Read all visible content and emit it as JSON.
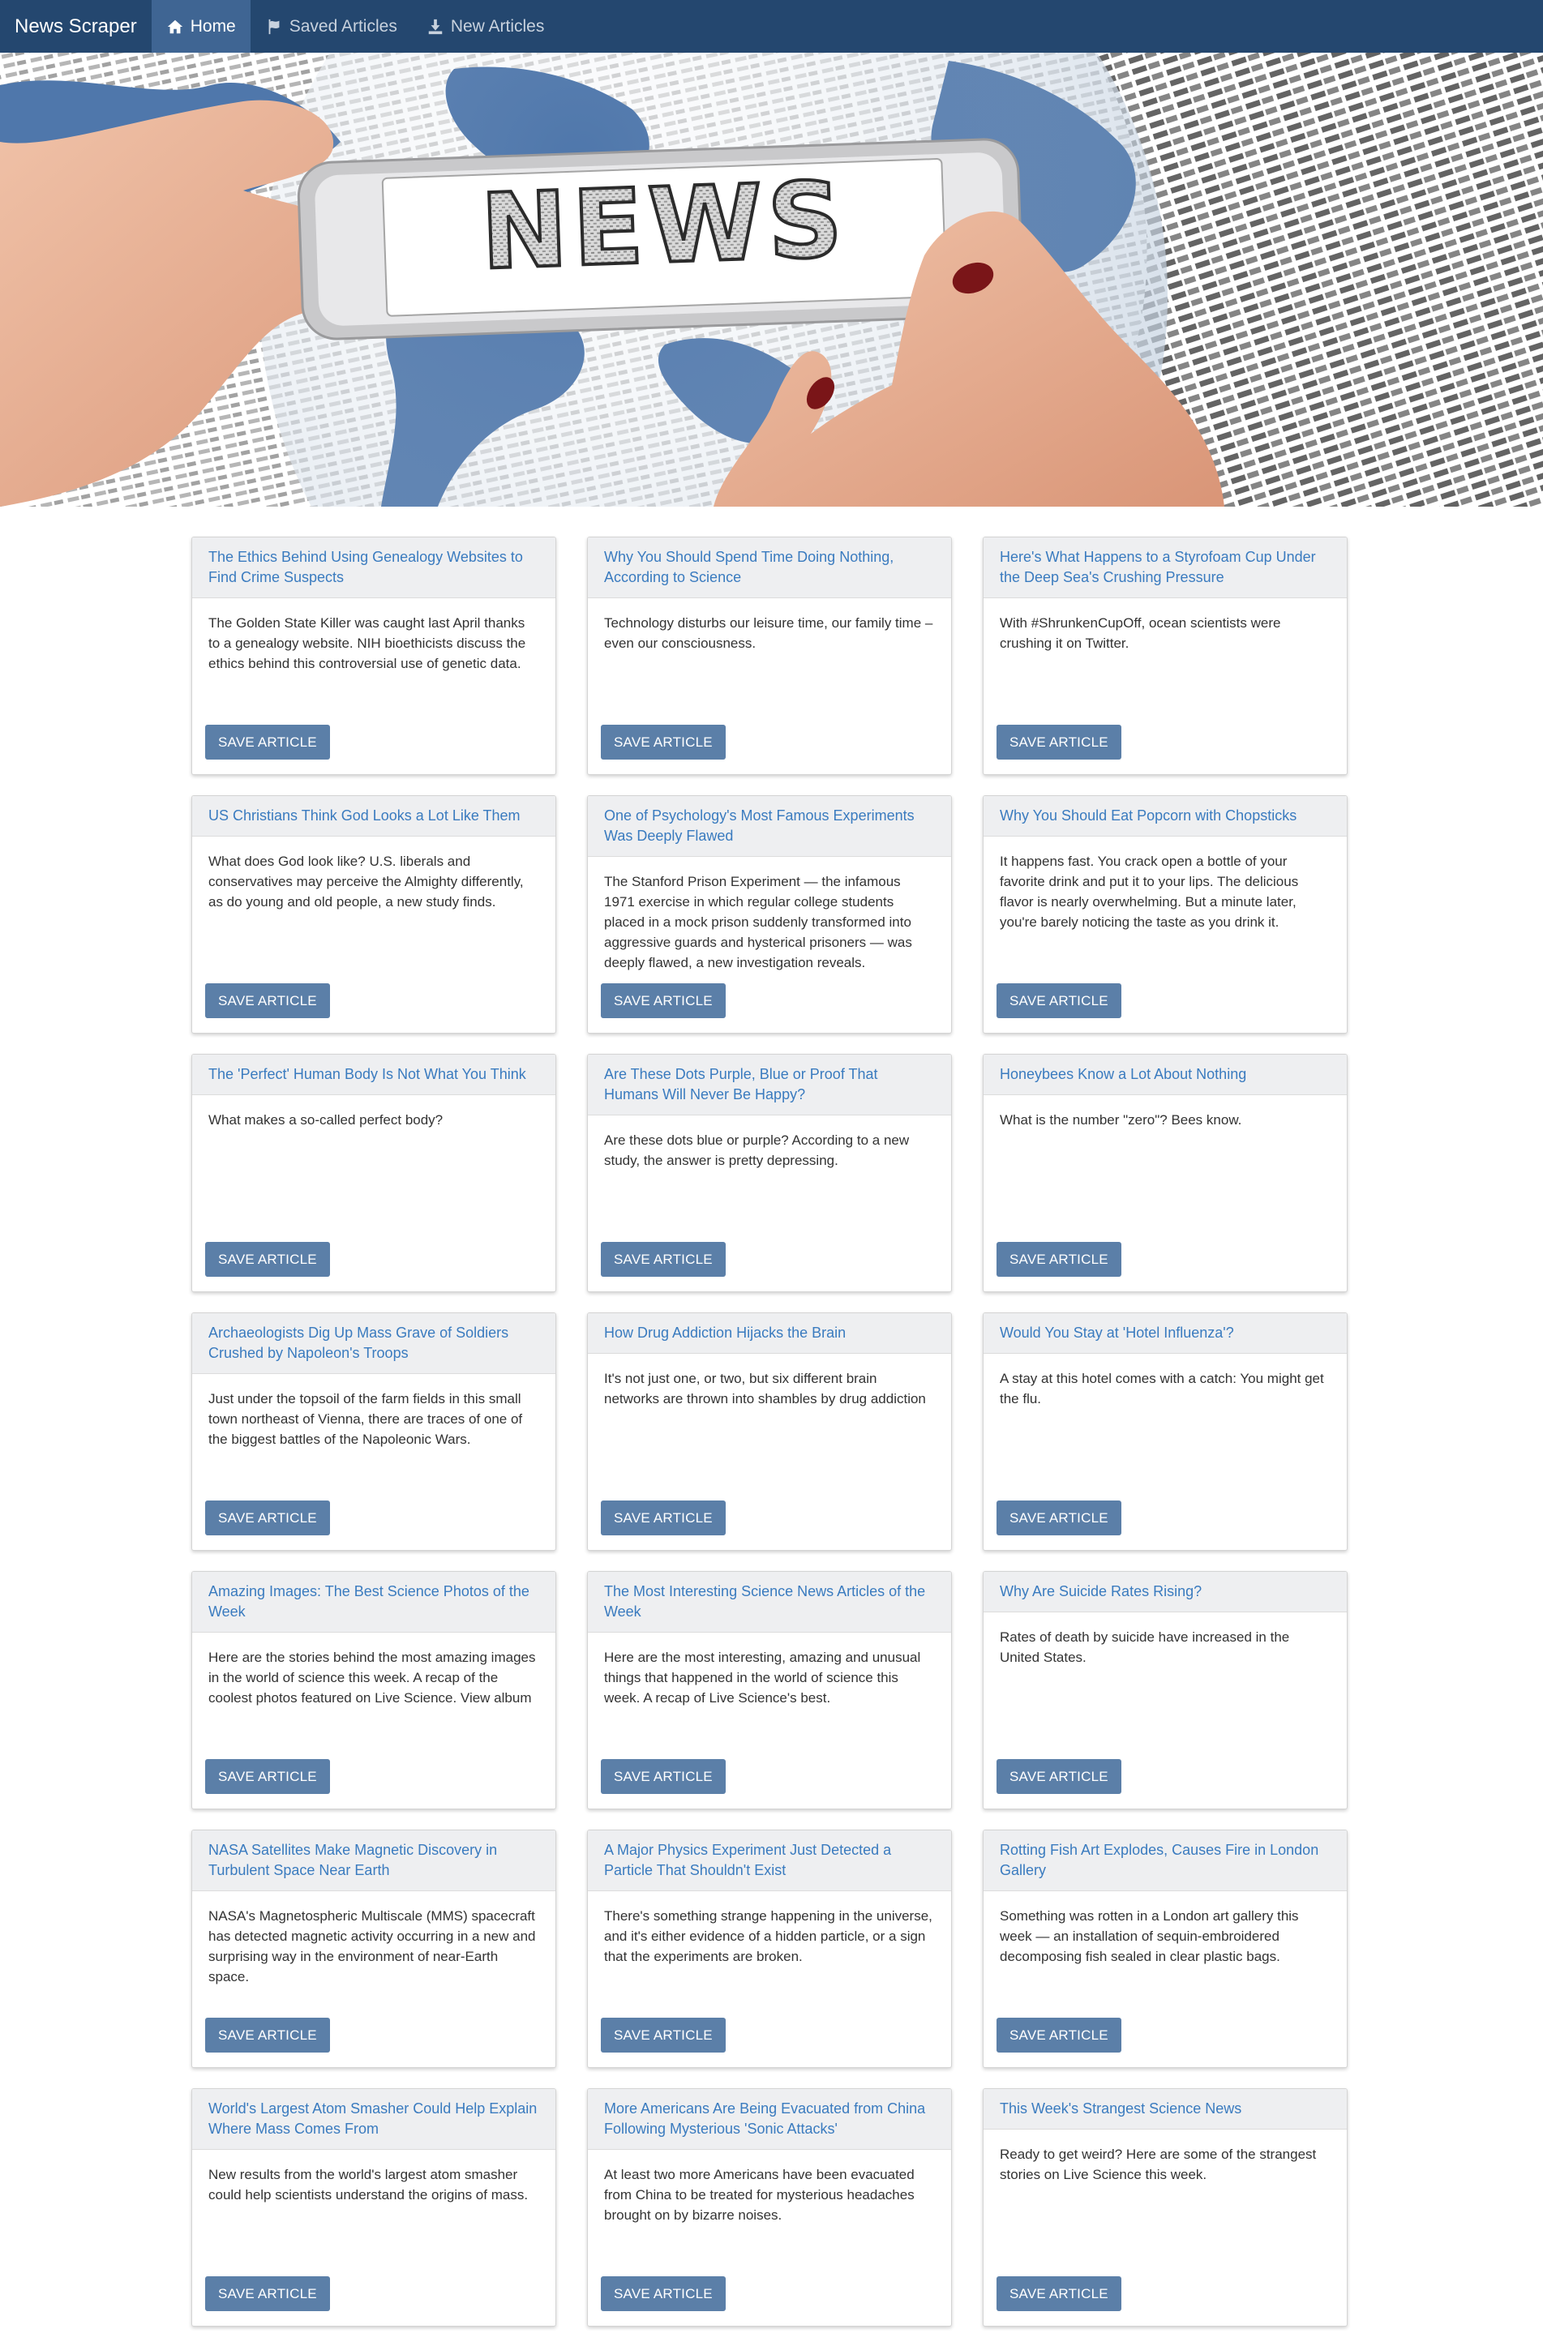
{
  "navbar": {
    "brand": "News Scraper",
    "items": [
      {
        "label": "Home",
        "icon": "home-icon",
        "active": true
      },
      {
        "label": "Saved Articles",
        "icon": "flag-icon",
        "active": false
      },
      {
        "label": "New Articles",
        "icon": "download-icon",
        "active": false
      }
    ]
  },
  "hero": {
    "screen_text": "NEWS"
  },
  "articles": [
    {
      "title": "The Ethics Behind Using Genealogy Websites to Find Crime Suspects",
      "summary": "The Golden State Killer was caught last April thanks to a genealogy website. NIH bioethicists discuss the ethics behind this controversial use of genetic data.",
      "button": "SAVE ARTICLE"
    },
    {
      "title": "Why You Should Spend Time Doing Nothing, According to Science",
      "summary": "Technology disturbs our leisure time, our family time – even our consciousness.",
      "button": "SAVE ARTICLE"
    },
    {
      "title": "Here's What Happens to a Styrofoam Cup Under the Deep Sea's Crushing Pressure",
      "summary": "With #ShrunkenCupOff, ocean scientists were crushing it on Twitter.",
      "button": "SAVE ARTICLE"
    },
    {
      "title": "US Christians Think God Looks a Lot Like Them",
      "summary": "What does God look like? U.S. liberals and conservatives may perceive the Almighty differently, as do young and old people, a new study finds.",
      "button": "SAVE ARTICLE"
    },
    {
      "title": "One of Psychology's Most Famous Experiments Was Deeply Flawed",
      "summary": "The Stanford Prison Experiment — the infamous 1971 exercise in which regular college students placed in a mock prison suddenly transformed into aggressive guards and hysterical prisoners — was deeply flawed, a new investigation reveals.",
      "button": "SAVE ARTICLE"
    },
    {
      "title": "Why You Should Eat Popcorn with Chopsticks",
      "summary": "It happens fast. You crack open a bottle of your favorite drink and put it to your lips. The delicious flavor is nearly overwhelming. But a minute later, you're barely noticing the taste as you drink it.",
      "button": "SAVE ARTICLE"
    },
    {
      "title": "The 'Perfect' Human Body Is Not What You Think",
      "summary": "What makes a so-called perfect body?",
      "button": "SAVE ARTICLE"
    },
    {
      "title": "Are These Dots Purple, Blue or Proof That Humans Will Never Be Happy?",
      "summary": "Are these dots blue or purple? According to a new study, the answer is pretty depressing.",
      "button": "SAVE ARTICLE"
    },
    {
      "title": "Honeybees Know a Lot About Nothing",
      "summary": "What is the number \"zero\"? Bees know.",
      "button": "SAVE ARTICLE"
    },
    {
      "title": "Archaeologists Dig Up Mass Grave of Soldiers Crushed by Napoleon's Troops",
      "summary": "Just under the topsoil of the farm fields in this small town northeast of Vienna, there are traces of one of the biggest battles of the Napoleonic Wars.",
      "button": "SAVE ARTICLE"
    },
    {
      "title": "How Drug Addiction Hijacks the Brain",
      "summary": "It's not just one, or two, but six different brain networks are thrown into shambles by drug addiction",
      "button": "SAVE ARTICLE"
    },
    {
      "title": "Would You Stay at 'Hotel Influenza'?",
      "summary": "A stay at this hotel comes with a catch: You might get the flu.",
      "button": "SAVE ARTICLE"
    },
    {
      "title": "Amazing Images: The Best Science Photos of the Week",
      "summary": "Here are the stories behind the most amazing images in the world of science this week. A recap of the coolest photos featured on Live Science. View album",
      "button": "SAVE ARTICLE"
    },
    {
      "title": "The Most Interesting Science News Articles of the Week",
      "summary": "Here are the most interesting, amazing and unusual things that happened in the world of science this week. A recap of Live Science's best.",
      "button": "SAVE ARTICLE"
    },
    {
      "title": "Why Are Suicide Rates Rising?",
      "summary": "Rates of death by suicide have increased in the United States.",
      "button": "SAVE ARTICLE"
    },
    {
      "title": "NASA Satellites Make Magnetic Discovery in Turbulent Space Near Earth",
      "summary": "NASA's Magnetospheric Multiscale (MMS) spacecraft has detected magnetic activity occurring in a new and surprising way in the environment of near-Earth space.",
      "button": "SAVE ARTICLE"
    },
    {
      "title": "A Major Physics Experiment Just Detected a Particle That Shouldn't Exist",
      "summary": "There's something strange happening in the universe, and it's either evidence of a hidden particle, or a sign that the experiments are broken.",
      "button": "SAVE ARTICLE"
    },
    {
      "title": "Rotting Fish Art Explodes, Causes Fire in London Gallery",
      "summary": "Something was rotten in a London art gallery this week — an installation of sequin-embroidered decomposing fish sealed in clear plastic bags.",
      "button": "SAVE ARTICLE"
    },
    {
      "title": "World's Largest Atom Smasher Could Help Explain Where Mass Comes From",
      "summary": "New results from the world's largest atom smasher could help scientists understand the origins of mass.",
      "button": "SAVE ARTICLE"
    },
    {
      "title": "More Americans Are Being Evacuated from China Following Mysterious 'Sonic Attacks'",
      "summary": "At least two more Americans have been evacuated from China to be treated for mysterious headaches brought on by bizarre noises.",
      "button": "SAVE ARTICLE"
    },
    {
      "title": "This Week's Strangest Science News",
      "summary": "Ready to get weird? Here are some of the strangest stories on Live Science this week.",
      "button": "SAVE ARTICLE"
    }
  ],
  "colors": {
    "navbar": "#24476f",
    "nav_active": "#3f6593",
    "link": "#3a7bbf",
    "button": "#5b7fa8",
    "card_header": "#eeeff1"
  }
}
